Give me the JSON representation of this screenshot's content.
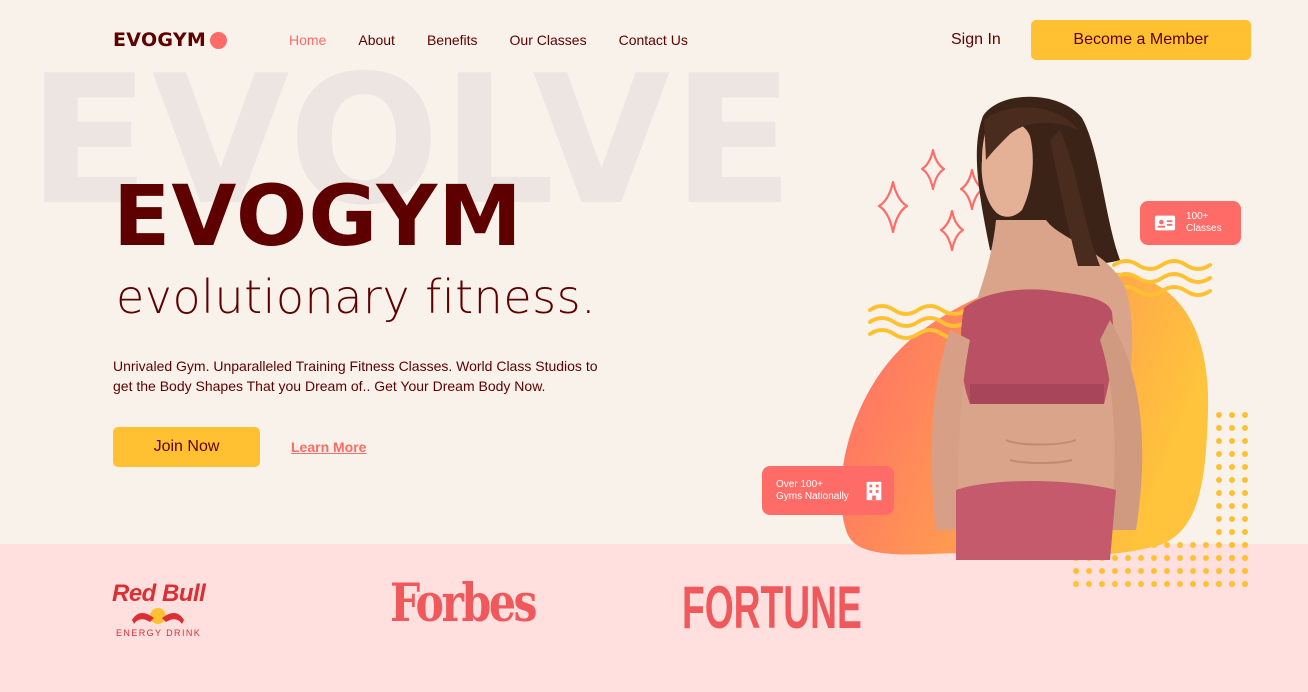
{
  "brand": {
    "logo_text": "EVOGYM"
  },
  "nav": {
    "links": [
      {
        "label": "Home",
        "active": true
      },
      {
        "label": "About"
      },
      {
        "label": "Benefits"
      },
      {
        "label": "Our Classes"
      },
      {
        "label": "Contact Us"
      }
    ],
    "sign_in": "Sign In",
    "cta": "Become a Member"
  },
  "hero": {
    "background_word": "EVOLVE",
    "title": "EVOGYM",
    "subtitle": "evolutionary fitness.",
    "description": "Unrivaled Gym. Unparalleled Training Fitness Classes. World Class Studios to get the Body Shapes That you Dream of.. Get Your Dream Body Now.",
    "primary_button": "Join Now",
    "secondary_link": "Learn More",
    "badges": {
      "classes_line1": "100+",
      "classes_line2": "Classes",
      "gyms_line1": "Over 100+",
      "gyms_line2": "Gyms Nationally"
    }
  },
  "sponsors": {
    "redbull": "Red Bull",
    "redbull_sub": "ENERGY DRINK",
    "forbes": "Forbes",
    "fortune": "FORTUNE"
  },
  "colors": {
    "background": "#f8f2ea",
    "primary_dark": "#5e0000",
    "accent_red": "#ff6b66",
    "accent_yellow": "#ffc132",
    "sponsor_band": "#ffe0df"
  }
}
